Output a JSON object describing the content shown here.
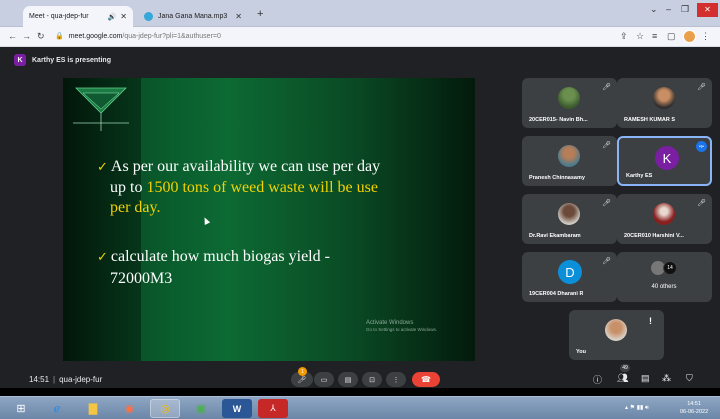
{
  "browser": {
    "tabs": [
      {
        "title": "Meet - qua-jdep-fur",
        "icon": "meet-icon",
        "audio": true,
        "active": true
      },
      {
        "title": "Jana Gana Mana.mp3",
        "icon": "music-icon",
        "audio": false,
        "active": false
      }
    ],
    "new_tab_label": "+",
    "url_host": "meet.google.com",
    "url_path": "/qua-jdep-fur?pli=1&authuser=0"
  },
  "meet": {
    "presenter_initial": "K",
    "presenting_label": "Karthy ES is presenting",
    "meeting_time": "14:51",
    "meeting_code": "qua-jdep-fur",
    "mic_badge_count": "1",
    "people_badge_count": "49",
    "slide": {
      "line1_bullet": "✓",
      "line1": "As per our availability we can use per day",
      "line2_a": "up to ",
      "line2_b": "1500 tons of weed waste will be use",
      "line3": "per day.",
      "line4_bullet": "✓",
      "line4": "calculate how much biogas yield -",
      "line5": "72000M3",
      "watermark_title": "Activate Windows",
      "watermark_sub": "Go to Settings to activate Windows."
    },
    "participants": [
      {
        "name": "20CER015- Navin Bh...",
        "type": "photo"
      },
      {
        "name": "RAMESH KUMAR S",
        "type": "photo"
      },
      {
        "name": "Pranesh Chinnasamy",
        "type": "photo"
      },
      {
        "name": "Karthy ES",
        "type": "letter",
        "letter": "K",
        "color": "#7b1fa2",
        "speaking": true
      },
      {
        "name": "Dr.Ravi Ekambaram",
        "type": "photo"
      },
      {
        "name": "20CER010 Harshini V...",
        "type": "photo"
      },
      {
        "name": "19CER004 Dharani R",
        "type": "letter",
        "letter": "D",
        "color": "#0b8fd8"
      },
      {
        "name": "40 others",
        "type": "group",
        "group_count": "14"
      },
      {
        "name": "You",
        "type": "photo"
      }
    ]
  },
  "taskbar": {
    "tray_time": "14:51",
    "tray_date": "06-06-2022"
  },
  "colors": {
    "meet_bg": "#202124",
    "tile_bg": "#3c4043",
    "hangup_red": "#ea4335",
    "slide_highlight": "#f2d200"
  }
}
